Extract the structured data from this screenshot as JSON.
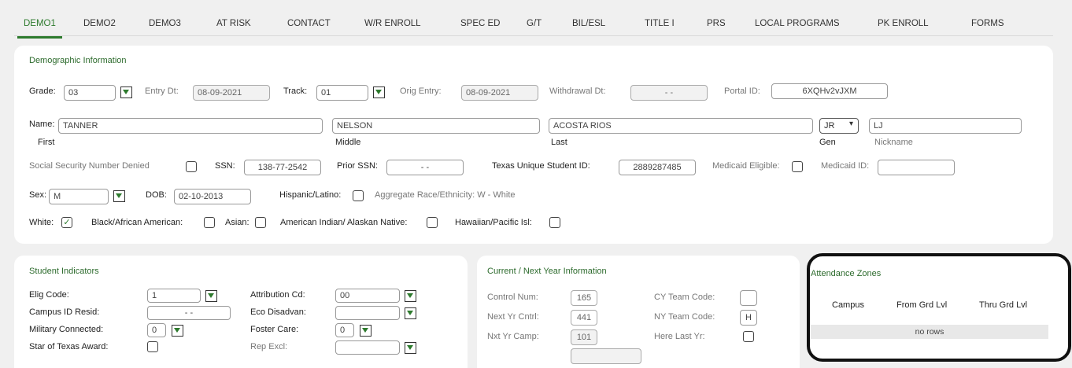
{
  "tabs": [
    "DEMO1",
    "DEMO2",
    "DEMO3",
    "AT RISK",
    "CONTACT",
    "W/R ENROLL",
    "SPEC ED",
    "G/T",
    "BIL/ESL",
    "TITLE I",
    "PRS",
    "LOCAL PROGRAMS",
    "PK ENROLL",
    "FORMS"
  ],
  "demographic": {
    "title": "Demographic Information",
    "grade_label": "Grade:",
    "grade": "03",
    "entry_dt_label": "Entry Dt:",
    "entry_dt": "08-09-2021",
    "track_label": "Track:",
    "track": "01",
    "orig_entry_label": "Orig Entry:",
    "orig_entry": "08-09-2021",
    "withdrawal_label": "Withdrawal Dt:",
    "withdrawal": "-  -",
    "portal_label": "Portal ID:",
    "portal": "6XQHv2vJXM",
    "name_label": "Name:",
    "first": "TANNER",
    "first_label": "First",
    "middle": "NELSON",
    "middle_label": "Middle",
    "last": "ACOSTA RIOS",
    "last_label": "Last",
    "gen": "JR",
    "gen_label": "Gen",
    "nickname": "LJ",
    "nickname_label": "Nickname",
    "ssn_denied_label": "Social Security Number Denied",
    "ssn_label": "SSN:",
    "ssn": "138-77-2542",
    "prior_ssn_label": "Prior SSN:",
    "prior_ssn": "-  -",
    "tsid_label": "Texas Unique Student ID:",
    "tsid": "2889287485",
    "medicaid_elig_label": "Medicaid Eligible:",
    "medicaid_id_label": "Medicaid ID:",
    "sex_label": "Sex:",
    "sex": "M",
    "dob_label": "DOB:",
    "dob": "02-10-2013",
    "hispanic_label": "Hispanic/Latino:",
    "aggregate": "Aggregate Race/Ethnicity: W - White",
    "white_label": "White:",
    "white_check": "✓",
    "black_label": "Black/African American:",
    "asian_label": "Asian:",
    "amind_label": "American Indian/ Alaskan Native:",
    "hawaiian_label": "Hawaiian/Pacific Isl:"
  },
  "indicators": {
    "title": "Student Indicators",
    "elig_label": "Elig Code:",
    "elig": "1",
    "attr_label": "Attribution Cd:",
    "attr": "00",
    "campus_resid_label": "Campus ID Resid:",
    "campus_resid": "-  -",
    "eco_label": "Eco Disadvan:",
    "eco": "",
    "military_label": "Military Connected:",
    "military": "0",
    "foster_label": "Foster Care:",
    "foster": "0",
    "star_label": "Star of Texas Award:",
    "rep_label": "Rep Excl:"
  },
  "current": {
    "title": "Current / Next Year Information",
    "control_label": "Control Num:",
    "control": "165",
    "cy_team_label": "CY Team Code:",
    "cy_team": "",
    "next_cntrl_label": "Next Yr Cntrl:",
    "next_cntrl": "441",
    "ny_team_label": "NY Team Code:",
    "ny_team": "H",
    "nxt_camp_label": "Nxt Yr Camp:",
    "nxt_camp": "101",
    "here_last_label": "Here Last Yr:"
  },
  "attendance": {
    "title": "Attendance Zones",
    "columns": [
      "Campus",
      "From Grd Lvl",
      "Thru Grd Lvl"
    ],
    "empty": "no rows"
  },
  "colors": {
    "accent": "#2d7a2d",
    "highlight_border": "#111111"
  }
}
